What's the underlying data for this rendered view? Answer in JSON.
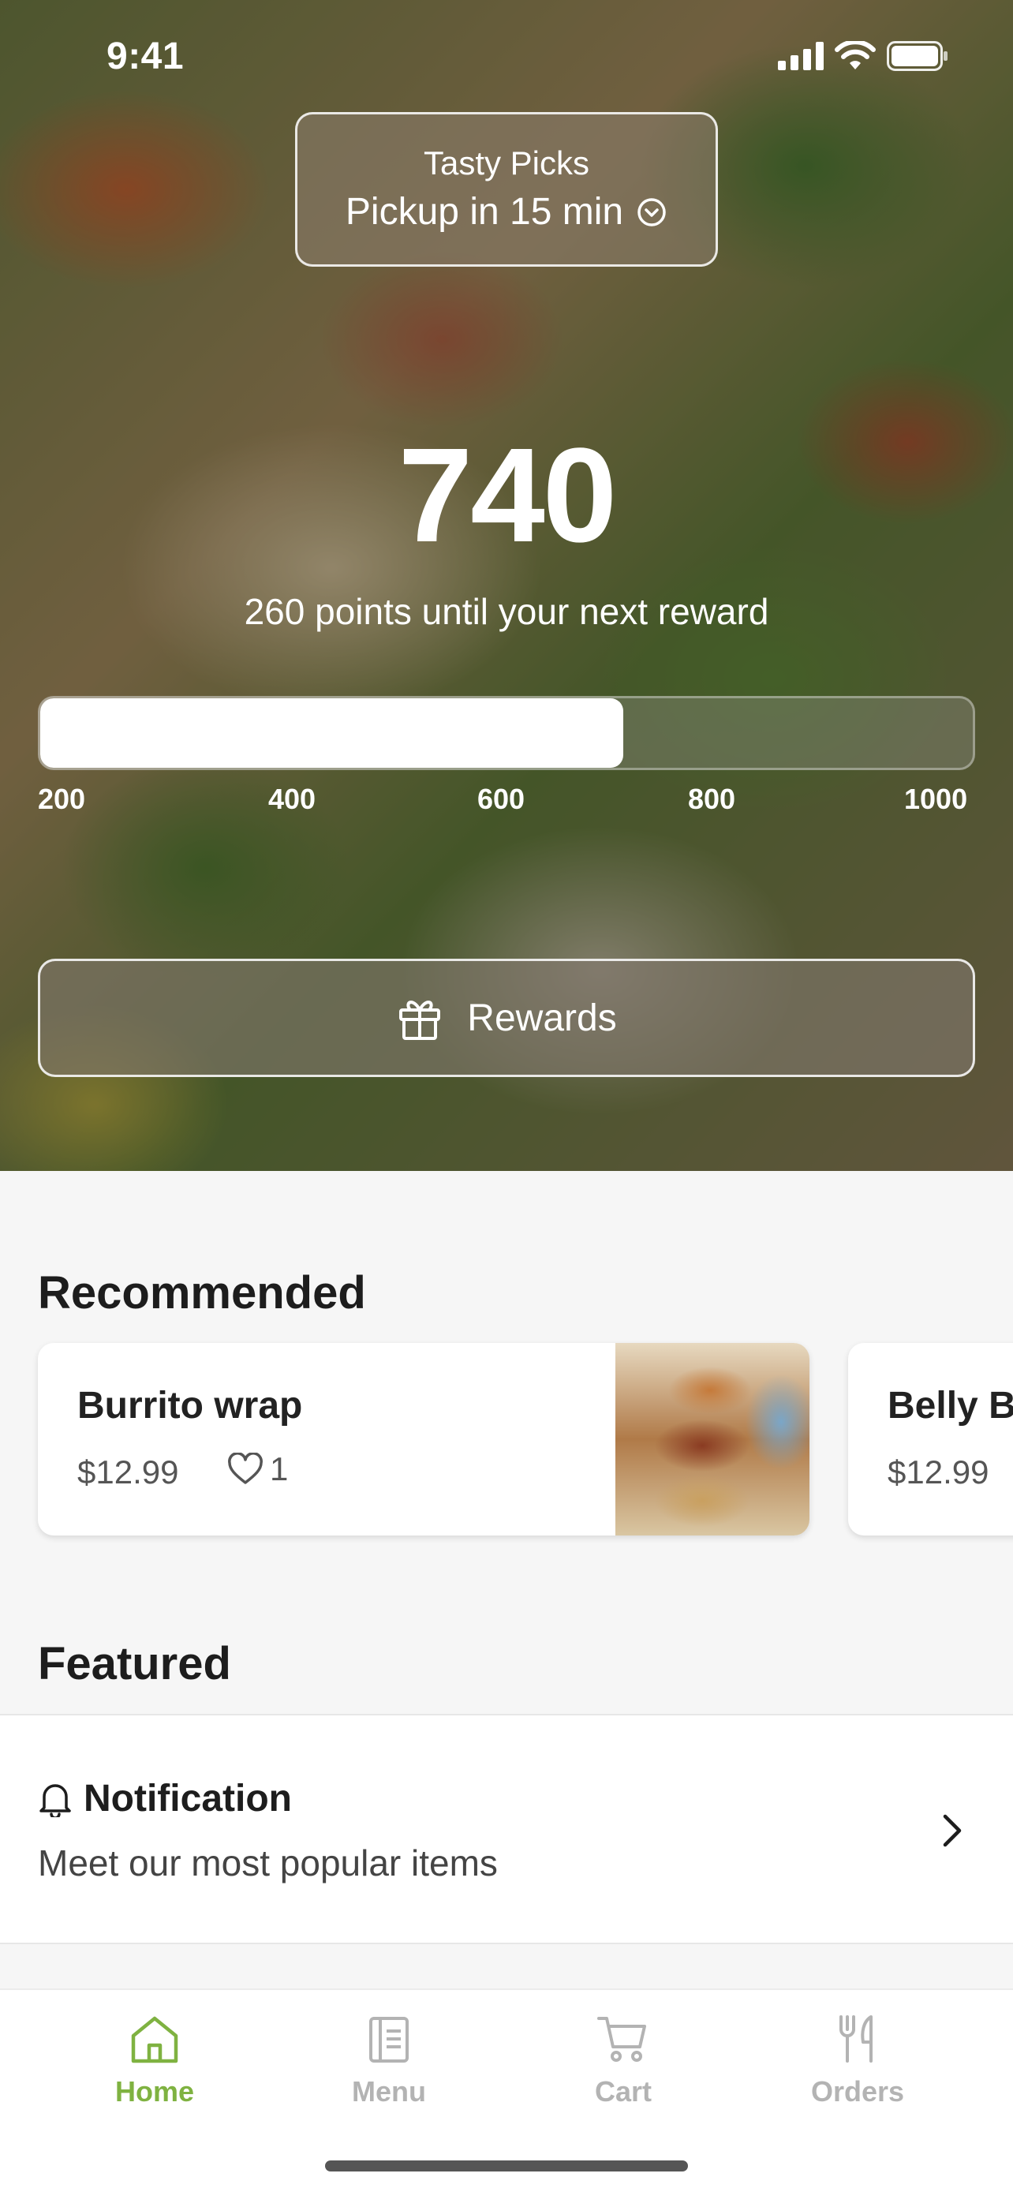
{
  "status_bar": {
    "time": "9:41"
  },
  "store": {
    "name": "Tasty Picks",
    "pickup": "Pickup in 15 min"
  },
  "rewards": {
    "points": "740",
    "caption": "260 points until your next reward",
    "progress_fraction": 0.625,
    "scale_labels": [
      "200",
      "400",
      "600",
      "800",
      "1000"
    ],
    "button_label": "Rewards"
  },
  "recommended": {
    "title": "Recommended",
    "items": [
      {
        "name": "Burrito wrap",
        "price": "$12.99",
        "likes": "1"
      },
      {
        "name": "Belly B",
        "price": "$12.99"
      }
    ]
  },
  "featured": {
    "title": "Featured",
    "notification": {
      "title": "Notification",
      "subtitle": "Meet our most popular items"
    }
  },
  "tabs": [
    {
      "label": "Home",
      "icon": "home-icon",
      "active": true
    },
    {
      "label": "Menu",
      "icon": "menu-icon",
      "active": false
    },
    {
      "label": "Cart",
      "icon": "cart-icon",
      "active": false
    },
    {
      "label": "Orders",
      "icon": "orders-icon",
      "active": false
    }
  ],
  "colors": {
    "accent": "#7fb241",
    "inactive_tab": "#b3b3b3"
  }
}
